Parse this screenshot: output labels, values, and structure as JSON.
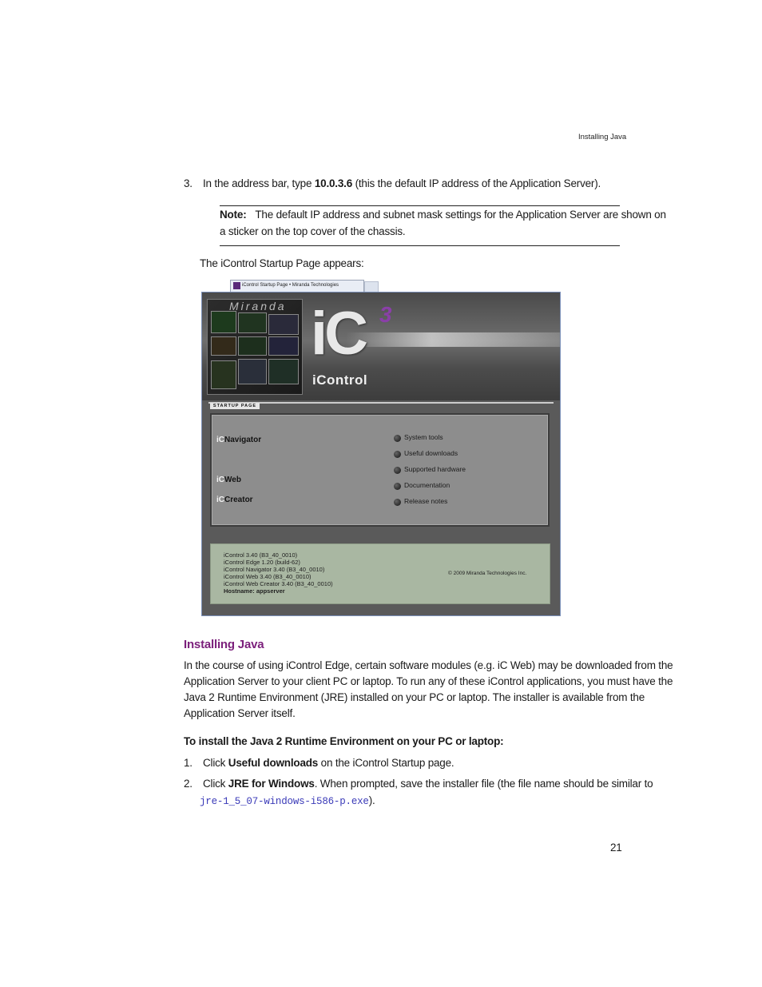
{
  "header": {
    "running_title": "Installing Java"
  },
  "step3": {
    "number": "3.",
    "before": "In the address bar, type ",
    "bold": "10.0.3.6",
    "after": " (this the default IP address of the Application Server)."
  },
  "note": {
    "label": "Note:",
    "text_line1": "The default IP address and subnet mask settings for the Application Server are shown on",
    "text_line2": "a sticker on the top cover of the chassis."
  },
  "startup_appears": "The iControl Startup Page appears:",
  "screenshot": {
    "tab_title": "iControl Startup Page • Miranda Technologies",
    "brand_watermark": "Miranda",
    "logo_letters": "iC",
    "logo_superscript": "3",
    "product_name": "iControl",
    "startup_tag": "STARTUP PAGE",
    "apps": [
      {
        "prefix": "iC",
        "name": "Navigator"
      },
      {
        "prefix": "iC",
        "name": "Web"
      },
      {
        "prefix": "iC",
        "name": "Creator"
      }
    ],
    "links": [
      "System tools",
      "Useful downloads",
      "Supported hardware",
      "Documentation",
      "Release notes"
    ],
    "versions": [
      "iControl 3.40 (B3_40_0010)",
      "iControl Edge 1.20 (build-62)",
      "iControl Navigator 3.40 (B3_40_0010)",
      "iControl Web 3.40 (B3_40_0010)",
      "iControl Web Creator 3.40 (B3_40_0010)",
      "Hostname: appserver"
    ],
    "copyright": "© 2009 Miranda Technologies Inc."
  },
  "section": {
    "heading": "Installing Java",
    "para_lines": [
      "In the course of using iControl Edge, certain software modules (e.g. iC Web) may be downloaded from the",
      "Application Server to your client PC or laptop. To run any of these iControl applications, you must have the",
      "Java 2 Runtime Environment (JRE) installed on your PC or laptop. The installer is available from the",
      "Application Server itself."
    ],
    "procedure_title": "To install the Java 2 Runtime Environment on your PC or laptop:",
    "step1": {
      "number": "1.",
      "before": "Click ",
      "bold": "Useful downloads",
      "after": " on the iControl Startup page."
    },
    "step2": {
      "number": "2.",
      "before": "Click ",
      "bold": "JRE for Windows",
      "after": ". When prompted, save the installer file (the file name should be similar to",
      "filename": "jre-1_5_07-windows-i586-p.exe",
      "end": ")."
    }
  },
  "footer": {
    "page_number": "21"
  }
}
